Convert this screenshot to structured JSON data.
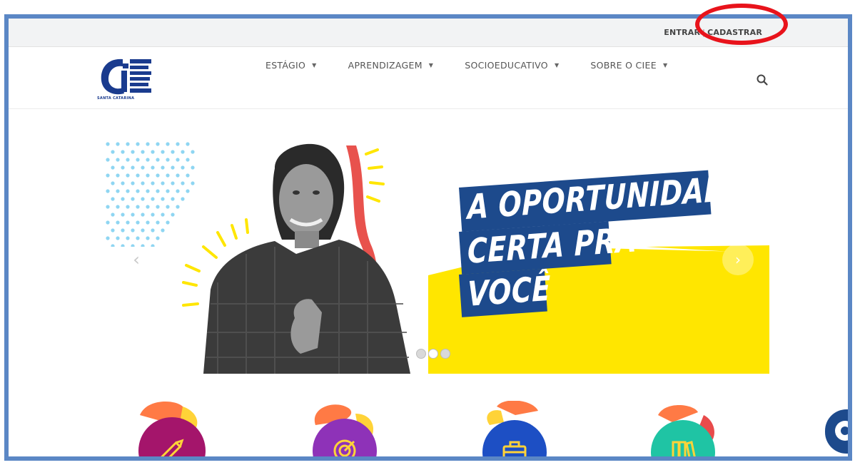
{
  "topbar": {
    "login_label": "ENTRAR",
    "separator": "|",
    "register_label": "CADASTRAR"
  },
  "logo": {
    "subtext": "SANTA CATARINA"
  },
  "nav": {
    "items": [
      {
        "label": "ESTÁGIO"
      },
      {
        "label": "APRENDIZAGEM"
      },
      {
        "label": "SOCIOEDUCATIVO"
      },
      {
        "label": "SOBRE O CIEE"
      }
    ]
  },
  "hero": {
    "headline_line1": "A OPORTUNIDADE",
    "headline_line2": "CERTA PRA",
    "headline_line3": "VOCÊ",
    "prev_arrow": "‹",
    "next_arrow": "›",
    "slide_count": 3,
    "active_slide": 2
  },
  "services": [
    {
      "icon": "pencil-icon",
      "color": "#a4156b"
    },
    {
      "icon": "target-icon",
      "color": "#8e32b8"
    },
    {
      "icon": "briefcase-icon",
      "color": "#1d4fc4"
    },
    {
      "icon": "books-icon",
      "color": "#1fc4a4"
    }
  ],
  "colors": {
    "brand_blue": "#1d4a8c",
    "hero_yellow": "#ffe600",
    "annotation_red": "#e8131b",
    "frame_blue": "#5b87c5"
  }
}
